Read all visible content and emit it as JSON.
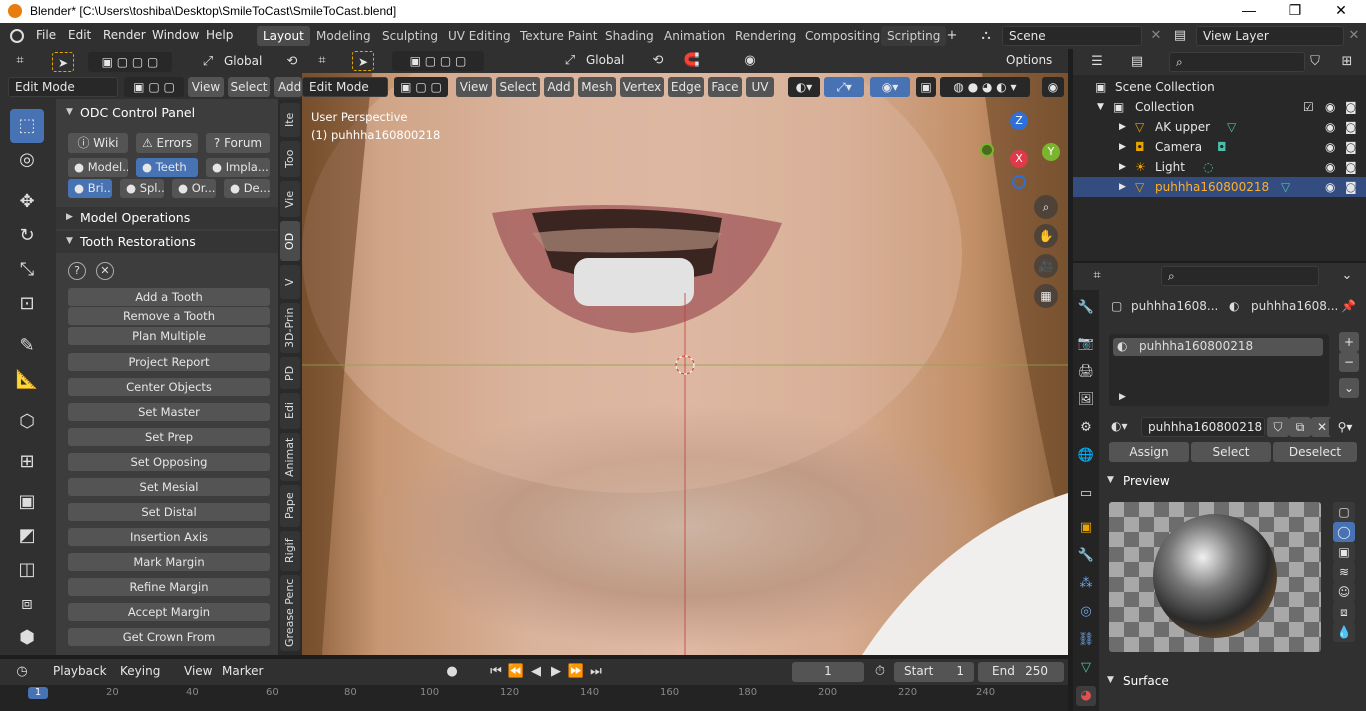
{
  "titlebar": {
    "title": "Blender* [C:\\Users\\toshiba\\Desktop\\SmileToCast\\SmileToCast.blend]",
    "minimize": "—",
    "maximize": "❐",
    "close": "✕"
  },
  "menu": [
    "File",
    "Edit",
    "Render",
    "Window",
    "Help"
  ],
  "workspaces": [
    "Layout",
    "Modeling",
    "Sculpting",
    "UV Editing",
    "Texture Paint",
    "Shading",
    "Animation",
    "Rendering",
    "Compositing",
    "Scripting"
  ],
  "active_workspace": "Layout",
  "scene": "Scene",
  "view_layer": "View Layer",
  "left_header": {
    "orientation": "Global",
    "mode": "Edit Mode",
    "view": "View",
    "select": "Select",
    "add": "Add"
  },
  "viewport_header": {
    "orientation": "Global",
    "options": "Options",
    "mode": "Edit Mode",
    "menus": [
      "View",
      "Select",
      "Add",
      "Mesh",
      "Vertex",
      "Edge",
      "Face",
      "UV"
    ]
  },
  "viewport": {
    "perspective": "User Perspective",
    "object": "(1) puhhha160800218",
    "gizmo": {
      "z": "Z",
      "x": "X",
      "y": "Y"
    }
  },
  "odc": {
    "title": "ODC Control Panel",
    "links": [
      "Wiki",
      "Errors",
      "Forum"
    ],
    "tabs_row1": [
      "Model...",
      "Teeth",
      "Impla..."
    ],
    "tabs_row2": [
      "Bri...",
      "Spl...",
      "Or...",
      "De..."
    ],
    "active_tab": "Teeth",
    "section_model_ops": "Model Operations",
    "section_tooth": "Tooth Restorations",
    "buttons": [
      "Add a Tooth",
      "Remove a Tooth",
      "Plan Multiple",
      "Project Report",
      "Center Objects",
      "Set Master",
      "Set Prep",
      "Set Opposing",
      "Set Mesial",
      "Set Distal",
      "Insertion Axis",
      "Mark Margin",
      "Refine Margin",
      "Accept Margin",
      "Get Crown From"
    ]
  },
  "vertical_tabs": [
    "Ite",
    "Too",
    "Vie",
    "OD",
    "V",
    "3D-Prin",
    "PD",
    "Edi",
    "Animat",
    "Pape",
    "Rigif",
    "Grease Penc"
  ],
  "active_vertical_tab": "OD",
  "outliner": {
    "root": "Scene Collection",
    "collection": "Collection",
    "items": [
      {
        "name": "AK upper",
        "selected": false
      },
      {
        "name": "Camera",
        "selected": false
      },
      {
        "name": "Light",
        "selected": false
      },
      {
        "name": "puhhha160800218",
        "selected": true
      }
    ]
  },
  "properties": {
    "breadcrumb_object": "puhhha1608...",
    "breadcrumb_material": "puhhha1608...",
    "slot": "puhhha160800218",
    "material_name": "puhhha160800218",
    "assign": "Assign",
    "select": "Select",
    "deselect": "Deselect",
    "preview_label": "Preview",
    "surface_label": "Surface"
  },
  "timeline": {
    "menus": [
      "Playback",
      "Keying",
      "View",
      "Marker"
    ],
    "current_frame": "1",
    "start_label": "Start",
    "start": "1",
    "end_label": "End",
    "end": "250"
  },
  "ruler_ticks": [
    "1",
    "20",
    "40",
    "60",
    "80",
    "100",
    "120",
    "140",
    "160",
    "180",
    "200",
    "220",
    "240"
  ],
  "colors": {
    "accent": "#4772b3",
    "header": "#303030",
    "panel": "#3d3d3d",
    "button": "#545454",
    "brand": "#e87d0d"
  }
}
